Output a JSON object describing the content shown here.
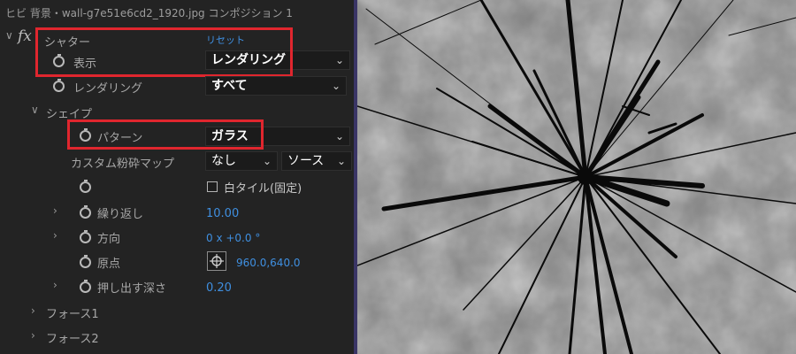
{
  "header": {
    "title": "ヒビ 背景・wall-g7e51e6cd2_1920.jpg コンポジション 1"
  },
  "effect": {
    "toggle": "∨",
    "fx": "fx",
    "name": "シャター",
    "reset": "リセット"
  },
  "rows": {
    "display": {
      "label": "表示",
      "value": "レンダリング"
    },
    "render": {
      "label": "レンダリング",
      "value": "すべて"
    },
    "shape": {
      "label": "シェイプ",
      "toggle": "∨"
    },
    "pattern": {
      "label": "パターン",
      "value": "ガラス"
    },
    "custom_map": {
      "label": "カスタム粉砕マップ",
      "value": "なし",
      "source": "ソース"
    },
    "white_tile": {
      "label": "白タイル(固定)",
      "checked": false
    },
    "repeat": {
      "label": "繰り返し",
      "value": "10.00"
    },
    "direction": {
      "label": "方向",
      "value": "0 x +0.0 °"
    },
    "origin": {
      "label": "原点",
      "value": "960.0,640.0"
    },
    "extrude": {
      "label": "押し出す深さ",
      "value": "0.20"
    },
    "force1": {
      "label": "フォース1"
    },
    "force2": {
      "label": "フォース2"
    }
  },
  "theme": {
    "accent_blue": "#3f8fe0",
    "highlight_red": "#e0262e",
    "panel_bg": "#232323"
  },
  "preview": {
    "description_icon": "shattered-glass-preview"
  }
}
